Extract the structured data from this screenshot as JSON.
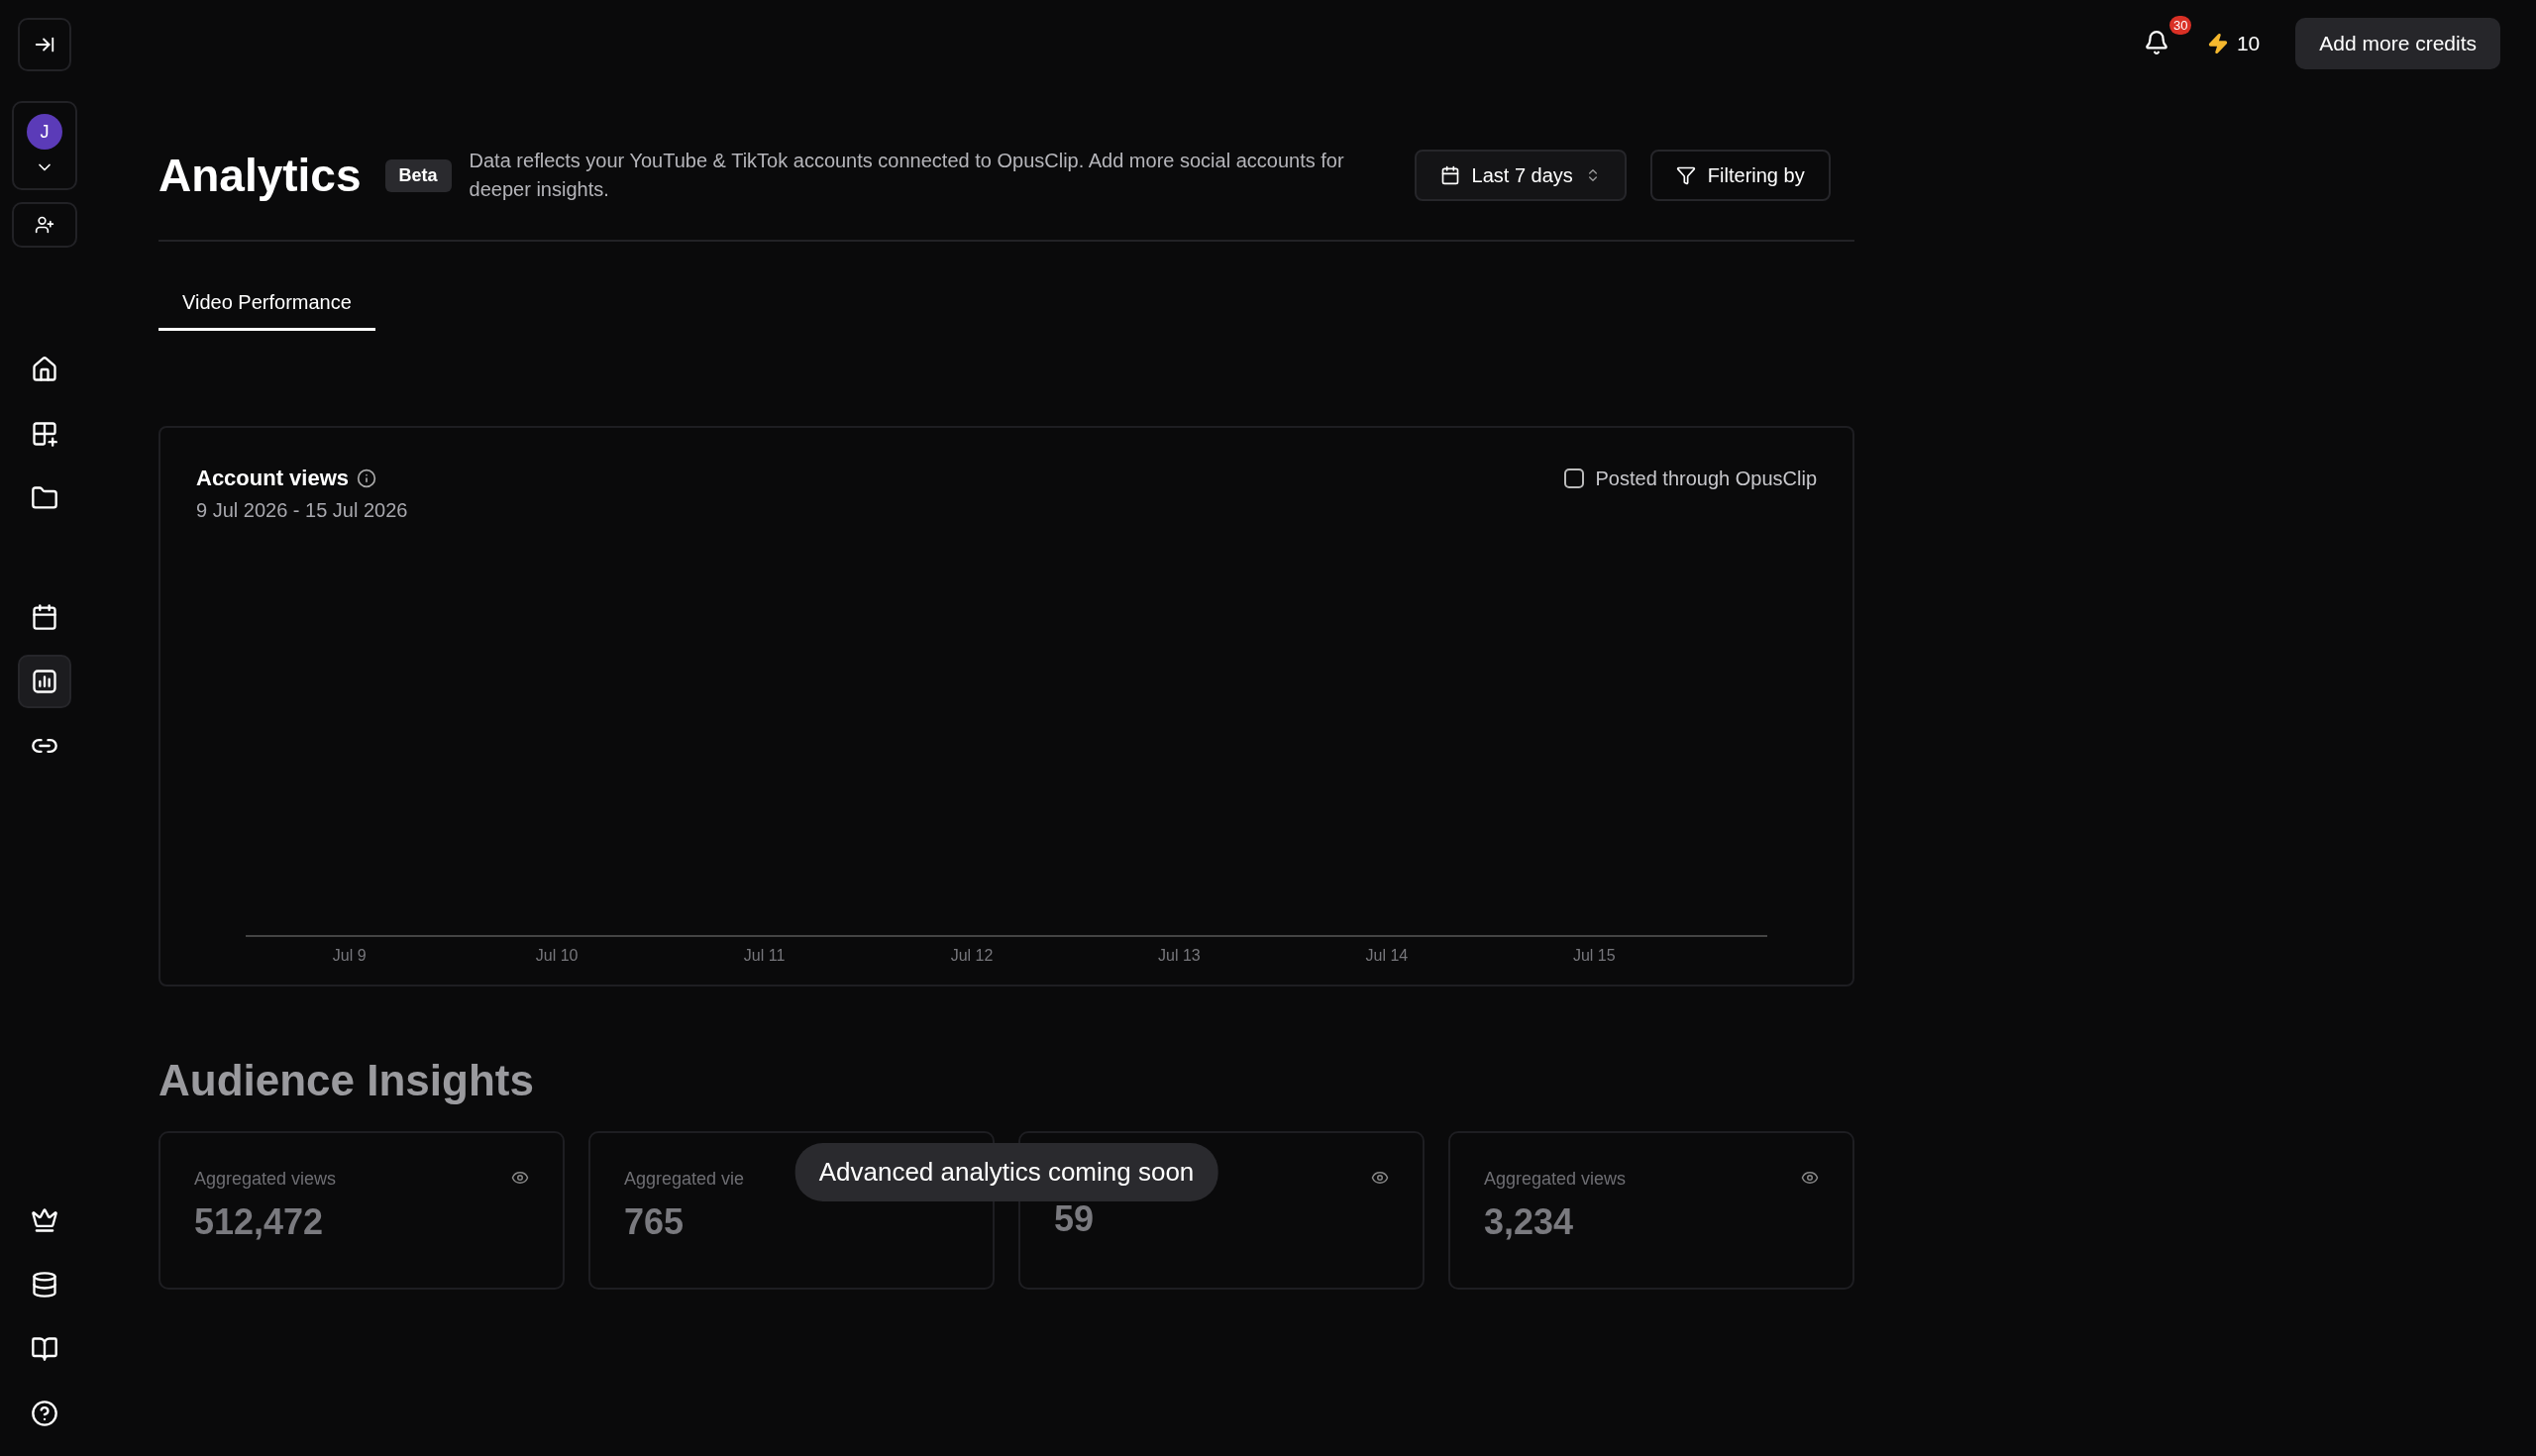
{
  "sidebar": {
    "avatar": {
      "initial": "J"
    },
    "items": [
      {
        "selected": false
      },
      {
        "selected": false
      },
      {
        "selected": false
      },
      {
        "selected": false
      },
      {
        "selected": true
      },
      {
        "selected": false
      }
    ]
  },
  "topbar": {
    "notifications": "30",
    "credits": "10",
    "cta": "Add more credits"
  },
  "header": {
    "title": "Analytics",
    "badge": "Beta",
    "description": "Data reflects your YouTube & TikTok accounts connected to OpusClip. Add more social accounts for deeper insights.",
    "date_range": "Last 7 days",
    "filter": "Filtering by"
  },
  "tabs": [
    {
      "label": "Video Performance",
      "selected": true
    }
  ],
  "chart_card": {
    "title": "Account views",
    "date_range": "9 Jul 2026 - 15 Jul 2026",
    "posted_filter": {
      "label": "Posted through OpusClip",
      "checked": false
    },
    "x_labels": [
      "Jul 9",
      "Jul 10",
      "Jul 11",
      "Jul 12",
      "Jul 13",
      "Jul 14",
      "Jul 15"
    ]
  },
  "audience_insights": {
    "title": "Audience Insights",
    "overlay": "Advanced analytics coming soon",
    "cards": [
      {
        "label": "Aggregated views",
        "value": "512,472"
      },
      {
        "label": "Aggregated vie",
        "value": "765"
      },
      {
        "value": "59"
      },
      {
        "label": "Aggregated views",
        "value": "3,234"
      }
    ]
  }
}
